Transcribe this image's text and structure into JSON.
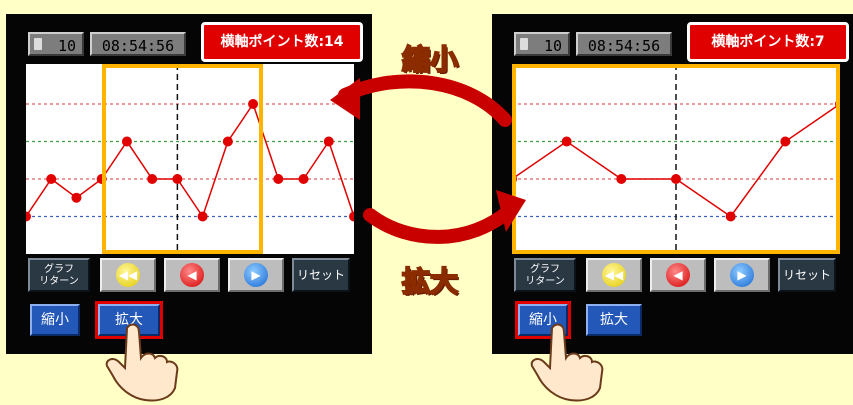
{
  "panels": {
    "left": {
      "counter": "10",
      "clock": "08:54:56",
      "point_count": "横軸ポイント数:14",
      "graph_return": "グラフ\nリターン",
      "reset": "リセット",
      "zoom_out": "縮小",
      "zoom_in": "拡大",
      "highlighted": "拡大"
    },
    "right": {
      "counter": "10",
      "clock": "08:54:56",
      "point_count": "横軸ポイント数:7",
      "graph_return": "グラフ\nリターン",
      "reset": "リセット",
      "zoom_out": "縮小",
      "zoom_in": "拡大",
      "highlighted": "縮小"
    }
  },
  "labels": {
    "shrink": "縮小",
    "enlarge": "拡大"
  },
  "chart_data": [
    {
      "type": "line",
      "title": "",
      "x": [
        1,
        2,
        3,
        4,
        5,
        6,
        7,
        8,
        9,
        10,
        11,
        12,
        13,
        14
      ],
      "series": [
        {
          "values": [
            1,
            2,
            1.5,
            2,
            3,
            2,
            2,
            1,
            3,
            4,
            2,
            2,
            3,
            1
          ]
        }
      ],
      "reference_lines": [
        1,
        2,
        3,
        4
      ],
      "cursor_x": 7,
      "grid": false
    },
    {
      "type": "line",
      "title": "",
      "x": [
        1,
        2,
        3,
        4,
        5,
        6,
        7
      ],
      "series": [
        {
          "values": [
            2,
            3,
            2,
            2,
            1,
            3,
            4
          ]
        }
      ],
      "reference_lines": [
        1,
        2,
        3,
        4
      ],
      "cursor_x": 4,
      "grid": false
    }
  ],
  "colors": {
    "background": "#ffffc6",
    "panel": "#050505",
    "chart_bg": "#ffffff",
    "line": "#e00000",
    "ref_top": "#e06060",
    "ref_green": "#40a040",
    "ref_red": "#e06060",
    "ref_blue": "#4060c0",
    "select_box": "#ffb400",
    "arrow": "#c80000",
    "badge": "#e00000",
    "zoom_button": "#2357b8"
  },
  "icons": [
    "fast-backward-icon",
    "backward-icon",
    "forward-icon",
    "fast-forward-icon",
    "pointing-hand-icon",
    "curved-arrow-icon"
  ]
}
